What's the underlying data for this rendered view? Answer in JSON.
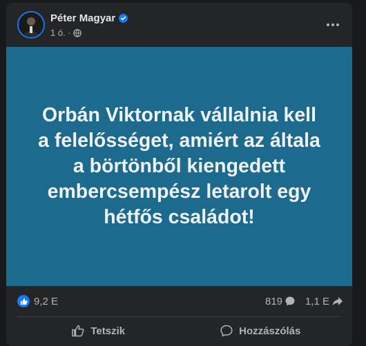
{
  "post": {
    "author": "Péter Magyar",
    "time": "1 ó. ·",
    "text": "Orbán Viktornak vállalnia kell\na felelősséget, amiért az általa\na börtönből kiengedett\nembercsempész letarolt egy\nhétfős családot!",
    "image_bg": "#1c6a8e"
  },
  "stats": {
    "reactions": "9,2 E",
    "comments": "819",
    "shares": "1,1 E"
  },
  "actions": {
    "like": "Tetszik",
    "comment": "Hozzászólás"
  },
  "icons": {
    "verified": "verified-badge-icon",
    "privacy": "globe-icon",
    "more": "more-options-icon",
    "like": "thumbs-up-icon",
    "comment": "comment-icon",
    "share": "share-icon"
  },
  "colors": {
    "accent": "#1877f2",
    "card": "#242526",
    "secondary_text": "#b0b3b8"
  }
}
